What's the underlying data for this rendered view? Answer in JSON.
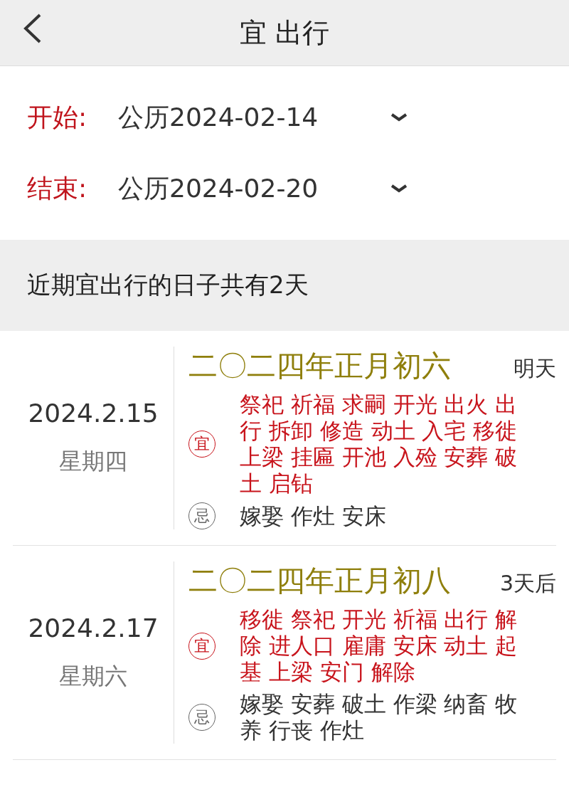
{
  "header": {
    "title": "宜 出行"
  },
  "range": [
    {
      "label": "开始:",
      "value": "公历2024-02-14"
    },
    {
      "label": "结束:",
      "value": "公历2024-02-20"
    }
  ],
  "summary": "近期宜出行的日子共有2天",
  "days": [
    {
      "date": "2024.2.15",
      "weekday": "星期四",
      "lunar": "二〇二四年正月初六",
      "relative": "明天",
      "rows": [
        {
          "kind": "yi",
          "mark": "宜",
          "text": "祭祀 祈福 求嗣 开光 出火 出行 拆卸 修造 动土 入宅 移徙上梁 挂匾 开池 入殓 安葬 破土 启钻"
        },
        {
          "kind": "ji",
          "mark": "忌",
          "text": "嫁娶 作灶 安床"
        }
      ]
    },
    {
      "date": "2024.2.17",
      "weekday": "星期六",
      "lunar": "二〇二四年正月初八",
      "relative": "3天后",
      "rows": [
        {
          "kind": "yi",
          "mark": "宜",
          "text": "移徙 祭祀 开光 祈福 出行 解除 进人口 雇庸 安床 动土 起基 上梁 安门 解除"
        },
        {
          "kind": "ji",
          "mark": "忌",
          "text": "嫁娶 安葬 破土 作梁 纳畜 牧养 行丧 作灶"
        }
      ]
    }
  ]
}
